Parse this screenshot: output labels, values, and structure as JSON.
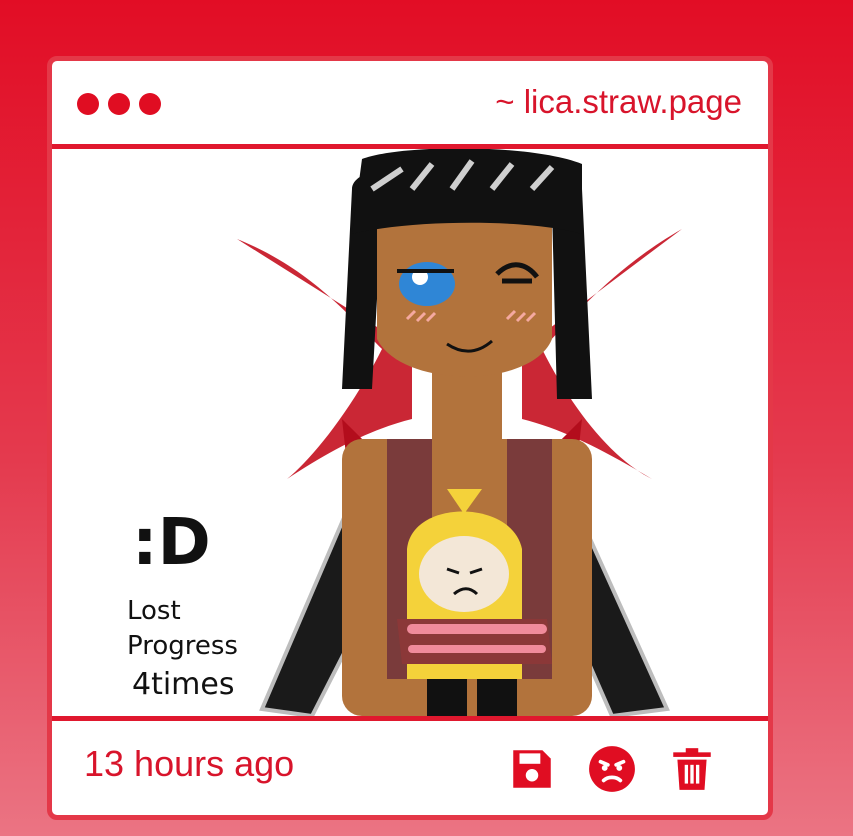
{
  "window": {
    "controls": [
      "dot",
      "dot",
      "dot"
    ],
    "url": "~ lica.straw.page"
  },
  "post": {
    "drawing": {
      "handwritten_text": [
        ":D",
        "Lost",
        "Progress",
        "4times"
      ]
    },
    "timestamp": "13 hours ago"
  },
  "actions": [
    {
      "icon": "save-icon",
      "label": "Save"
    },
    {
      "icon": "angry-face-icon",
      "label": "React"
    },
    {
      "icon": "trash-icon",
      "label": "Delete"
    }
  ],
  "colors": {
    "accent": "#e00d22",
    "border": "#e43848",
    "text": "#d8142b",
    "background_top": "#e20d25",
    "background_bottom": "#eb7483"
  }
}
